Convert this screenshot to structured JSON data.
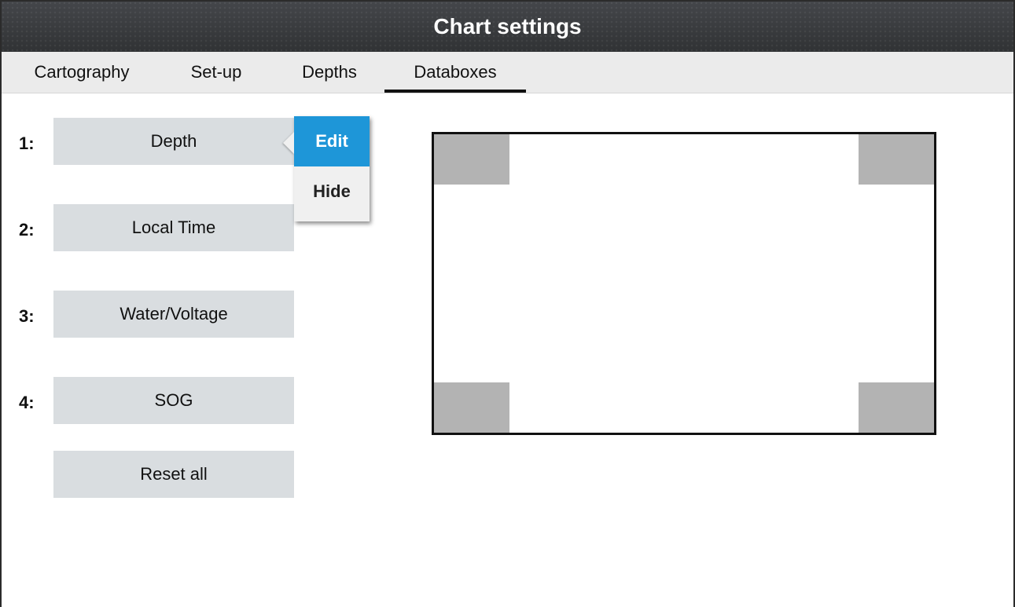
{
  "header": {
    "title": "Chart settings"
  },
  "tabs": [
    {
      "label": "Cartography",
      "active": false
    },
    {
      "label": "Set-up",
      "active": false
    },
    {
      "label": "Depths",
      "active": false
    },
    {
      "label": "Databoxes",
      "active": true
    }
  ],
  "databoxes": [
    {
      "number": "1:",
      "label": "Depth"
    },
    {
      "number": "2:",
      "label": "Local Time"
    },
    {
      "number": "3:",
      "label": "Water/Voltage"
    },
    {
      "number": "4:",
      "label": "SOG"
    }
  ],
  "reset_label": "Reset all",
  "context_menu": {
    "edit_label": "Edit",
    "hide_label": "Hide"
  },
  "colors": {
    "accent": "#1e96d8",
    "button_bg": "#d9dde0",
    "corner_box": "#b3b3b3",
    "title_bar": "#3a3c3f"
  }
}
